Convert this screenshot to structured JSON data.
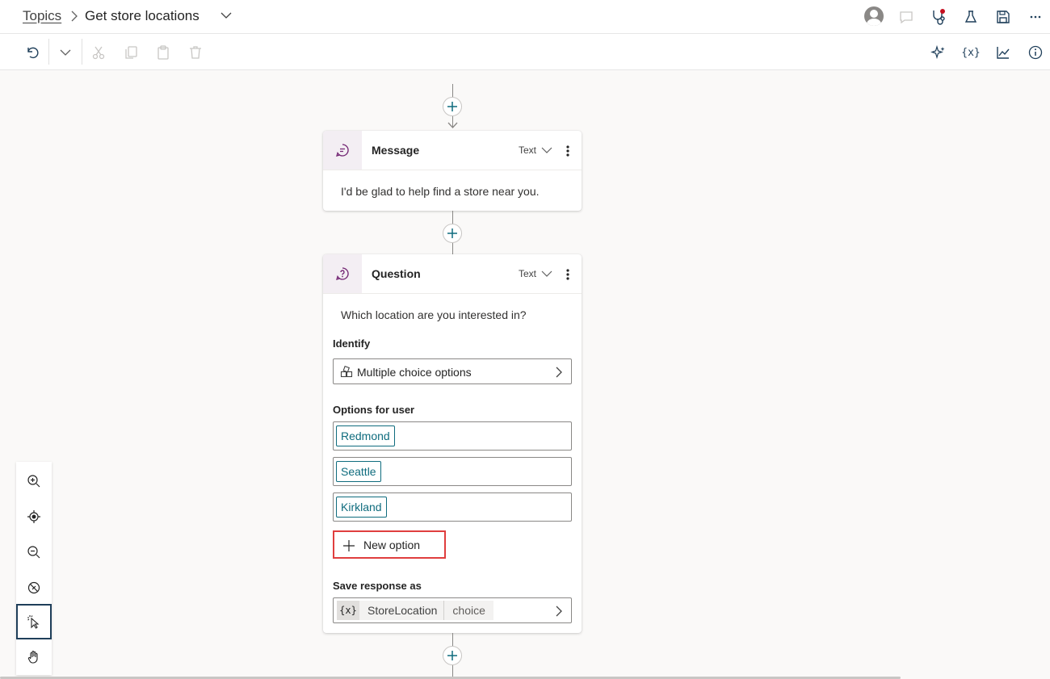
{
  "header": {
    "breadcrumb_root": "Topics",
    "topic_title": "Get store locations"
  },
  "nodes": {
    "message": {
      "title": "Message",
      "mode": "Text",
      "text": "I'd be glad to help find a store near you."
    },
    "question": {
      "title": "Question",
      "mode": "Text",
      "prompt": "Which location are you interested in?",
      "identify_label": "Identify",
      "identify_value": "Multiple choice options",
      "options_label": "Options for user",
      "options": [
        "Redmond",
        "Seattle",
        "Kirkland"
      ],
      "new_option_label": "New option",
      "save_label": "Save response as",
      "variable_icon": "{x}",
      "variable_name": "StoreLocation",
      "variable_type": "choice"
    }
  },
  "toolbar": {
    "variables_icon": "{x}"
  },
  "colors": {
    "accent": "#0f6c7e",
    "highlight": "#e03e3e",
    "node_icon_bg": "#f3eef3"
  }
}
